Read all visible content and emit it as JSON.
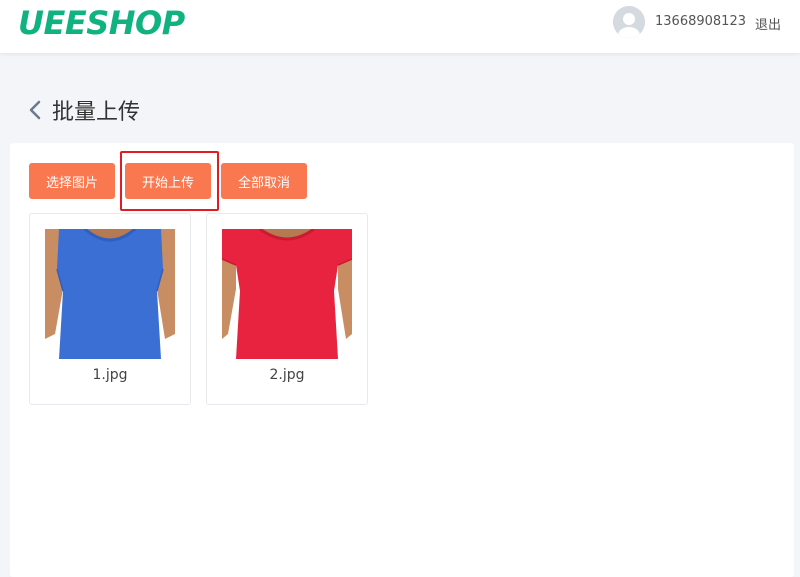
{
  "header": {
    "logo": "UEESHOP",
    "phone": "13668908123",
    "logout_label": "退出",
    "brand_color": "#10b280"
  },
  "page": {
    "title": "批量上传"
  },
  "toolbar": {
    "select_label": "选择图片",
    "start_label": "开始上传",
    "cancel_all_label": "全部取消",
    "button_color": "#f9784f"
  },
  "uploads": [
    {
      "filename": "1.jpg",
      "shirt_color": "#3b6fd4"
    },
    {
      "filename": "2.jpg",
      "shirt_color": "#e8233f"
    }
  ]
}
